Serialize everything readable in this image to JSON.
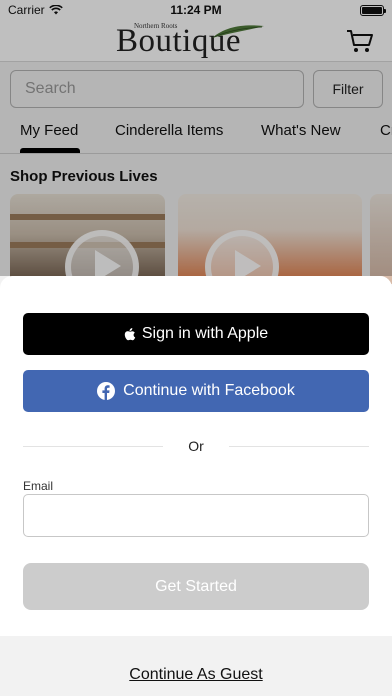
{
  "status_bar": {
    "carrier": "Carrier",
    "time": "11:24 PM"
  },
  "header": {
    "logo_small": "Northern Roots",
    "logo_main": "Boutique",
    "cart_icon": "cart-icon"
  },
  "search": {
    "placeholder": "Search",
    "filter_label": "Filter"
  },
  "tabs": [
    {
      "label": "My Feed",
      "active": true
    },
    {
      "label": "Cinderella Items",
      "active": false
    },
    {
      "label": "What's New",
      "active": false
    },
    {
      "label": "Cr",
      "active": false
    }
  ],
  "feed": {
    "section_title": "Shop Previous Lives"
  },
  "sheet": {
    "apple_label": "Sign in with Apple",
    "facebook_label": "Continue with Facebook",
    "or_label": "Or",
    "email_label": "Email",
    "email_value": "",
    "start_label": "Get Started"
  },
  "footer": {
    "guest_label": "Continue As Guest"
  },
  "colors": {
    "facebook_blue": "#4267b2",
    "apple_black": "#000000",
    "disabled_gray": "#cccccc"
  }
}
